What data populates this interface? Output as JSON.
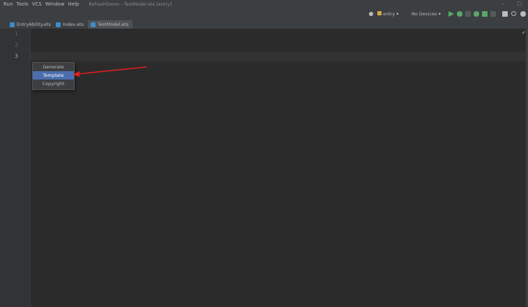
{
  "menu": {
    "items": [
      "Run",
      "Tools",
      "VCS",
      "Window",
      "Help"
    ],
    "window_title": "RefreshDemo - TestModel.ets [entry]"
  },
  "window_controls": [
    "–",
    "□"
  ],
  "toolbar": {
    "module": "entry",
    "devices": "No Devices"
  },
  "tabs": [
    {
      "label": "EntryAbility.ets",
      "active": false
    },
    {
      "label": "Index.ets",
      "active": false
    },
    {
      "label": "TestModel.ets",
      "active": true
    }
  ],
  "line_numbers": [
    "1",
    "2",
    "3"
  ],
  "popup": {
    "items": [
      {
        "label": "Generate",
        "selected": false
      },
      {
        "label": "Template",
        "selected": true
      },
      {
        "label": "Copyright",
        "selected": false
      }
    ]
  },
  "colors": {
    "accent": "#4b6eaf",
    "arrow": "#e0201c"
  }
}
